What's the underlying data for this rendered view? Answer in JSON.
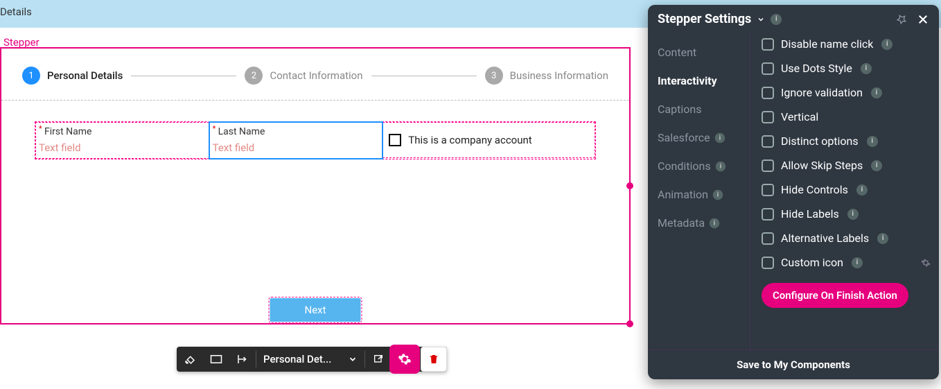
{
  "topbar": {
    "title": "Details"
  },
  "canvas": {
    "selection_label": "Stepper",
    "steps": [
      {
        "num": "1",
        "title": "Personal Details"
      },
      {
        "num": "2",
        "title": "Contact Information"
      },
      {
        "num": "3",
        "title": "Business Information"
      }
    ],
    "fields": {
      "first_name": {
        "label": "First Name",
        "placeholder": "Text field"
      },
      "last_name": {
        "label": "Last Name",
        "placeholder": "Text field"
      },
      "company_chk": {
        "label": "This is a company account"
      }
    },
    "next_label": "Next"
  },
  "toolbar": {
    "dropdown_label": "Personal Det..."
  },
  "settings": {
    "title": "Stepper Settings",
    "tabs": {
      "content": "Content",
      "interactivity": "Interactivity",
      "captions": "Captions",
      "salesforce": "Salesforce",
      "conditions": "Conditions",
      "animation": "Animation",
      "metadata": "Metadata"
    },
    "options": {
      "disable_name_click": "Disable name click",
      "use_dots": "Use Dots Style",
      "ignore_validation": "Ignore validation",
      "vertical": "Vertical",
      "distinct": "Distinct options",
      "skip": "Allow Skip Steps",
      "hide_controls": "Hide Controls",
      "hide_labels": "Hide Labels",
      "alt_labels": "Alternative Labels",
      "custom_icon": "Custom icon"
    },
    "action_label": "Configure On Finish Action",
    "footer": "Save to My Components"
  }
}
